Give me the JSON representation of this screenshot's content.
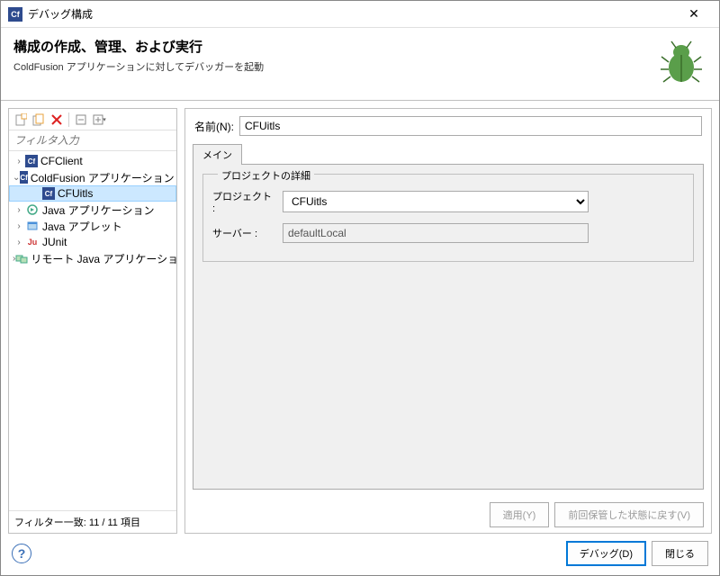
{
  "titlebar": {
    "title": "デバッグ構成"
  },
  "header": {
    "title": "構成の作成、管理、および実行",
    "subtitle": "ColdFusion アプリケーションに対してデバッガーを起動"
  },
  "filter": {
    "placeholder": "フィルタ入力"
  },
  "tree": {
    "items": [
      {
        "label": "CFClient"
      },
      {
        "label": "ColdFusion アプリケーション"
      },
      {
        "label": "CFUitls"
      },
      {
        "label": "Java アプリケーション"
      },
      {
        "label": "Java アプレット"
      },
      {
        "label": "JUnit"
      },
      {
        "label": "リモート Java アプリケーション"
      }
    ],
    "footer": "フィルター一致: 11 / 11 項目"
  },
  "form": {
    "name_label": "名前(N):",
    "name_value": "CFUitls",
    "tab_main": "メイン",
    "fieldset_title": "プロジェクトの詳細",
    "project_label": "プロジェクト :",
    "project_value": "CFUitls",
    "server_label": "サーバー :",
    "server_value": "defaultLocal",
    "apply": "適用(Y)",
    "revert": "前回保管した状態に戻す(V)"
  },
  "footer": {
    "debug": "デバッグ(D)",
    "close": "閉じる"
  }
}
